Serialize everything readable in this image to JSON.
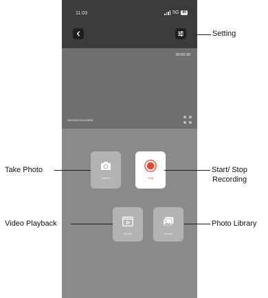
{
  "status_bar": {
    "time": "11:03",
    "network": "5G",
    "battery": "80"
  },
  "preview": {
    "recording_timer": "00:00:30",
    "timestamp": "05/20/2025 10:03:08PM"
  },
  "controls": {
    "capture_label": "Capture",
    "stop_label": "Stop",
    "videos_label": "Videos",
    "photos_label": "Photos"
  },
  "callouts": {
    "setting": "Setting",
    "take_photo": "Take Photo",
    "start_stop_line1": "Start/ Stop",
    "start_stop_line2": "Recording",
    "video_playback": "Video Playback",
    "photo_library": "Photo Library"
  },
  "colors": {
    "record_red": "#e8482f",
    "header_dark": "#3b3b3b",
    "panel_gray": "#8a8a8a"
  }
}
